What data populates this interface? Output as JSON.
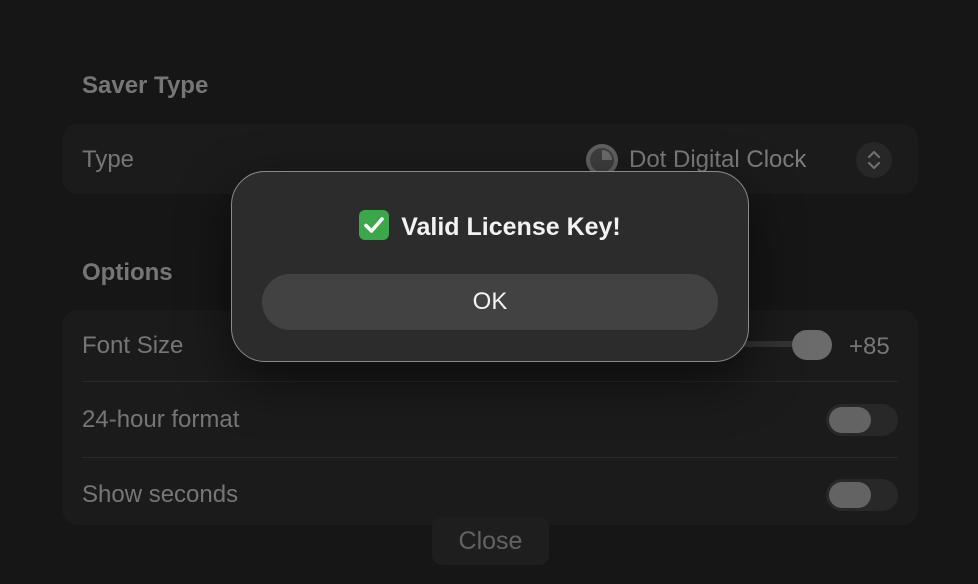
{
  "saver_type": {
    "section_title": "Saver Type",
    "type_label": "Type",
    "selected_value": "Dot Digital Clock",
    "selected_icon": "clock-icon"
  },
  "options": {
    "section_title": "Options",
    "font_size": {
      "label": "Font Size",
      "value_text": "+85"
    },
    "hour24": {
      "label": "24-hour format",
      "on": false
    },
    "show_seconds": {
      "label": "Show seconds",
      "on": false
    }
  },
  "footer": {
    "close_label": "Close"
  },
  "alert": {
    "title": "Valid License Key!",
    "icon": "check-mark-button-icon",
    "ok_label": "OK"
  },
  "colors": {
    "accent_check": "#3aa84a"
  }
}
